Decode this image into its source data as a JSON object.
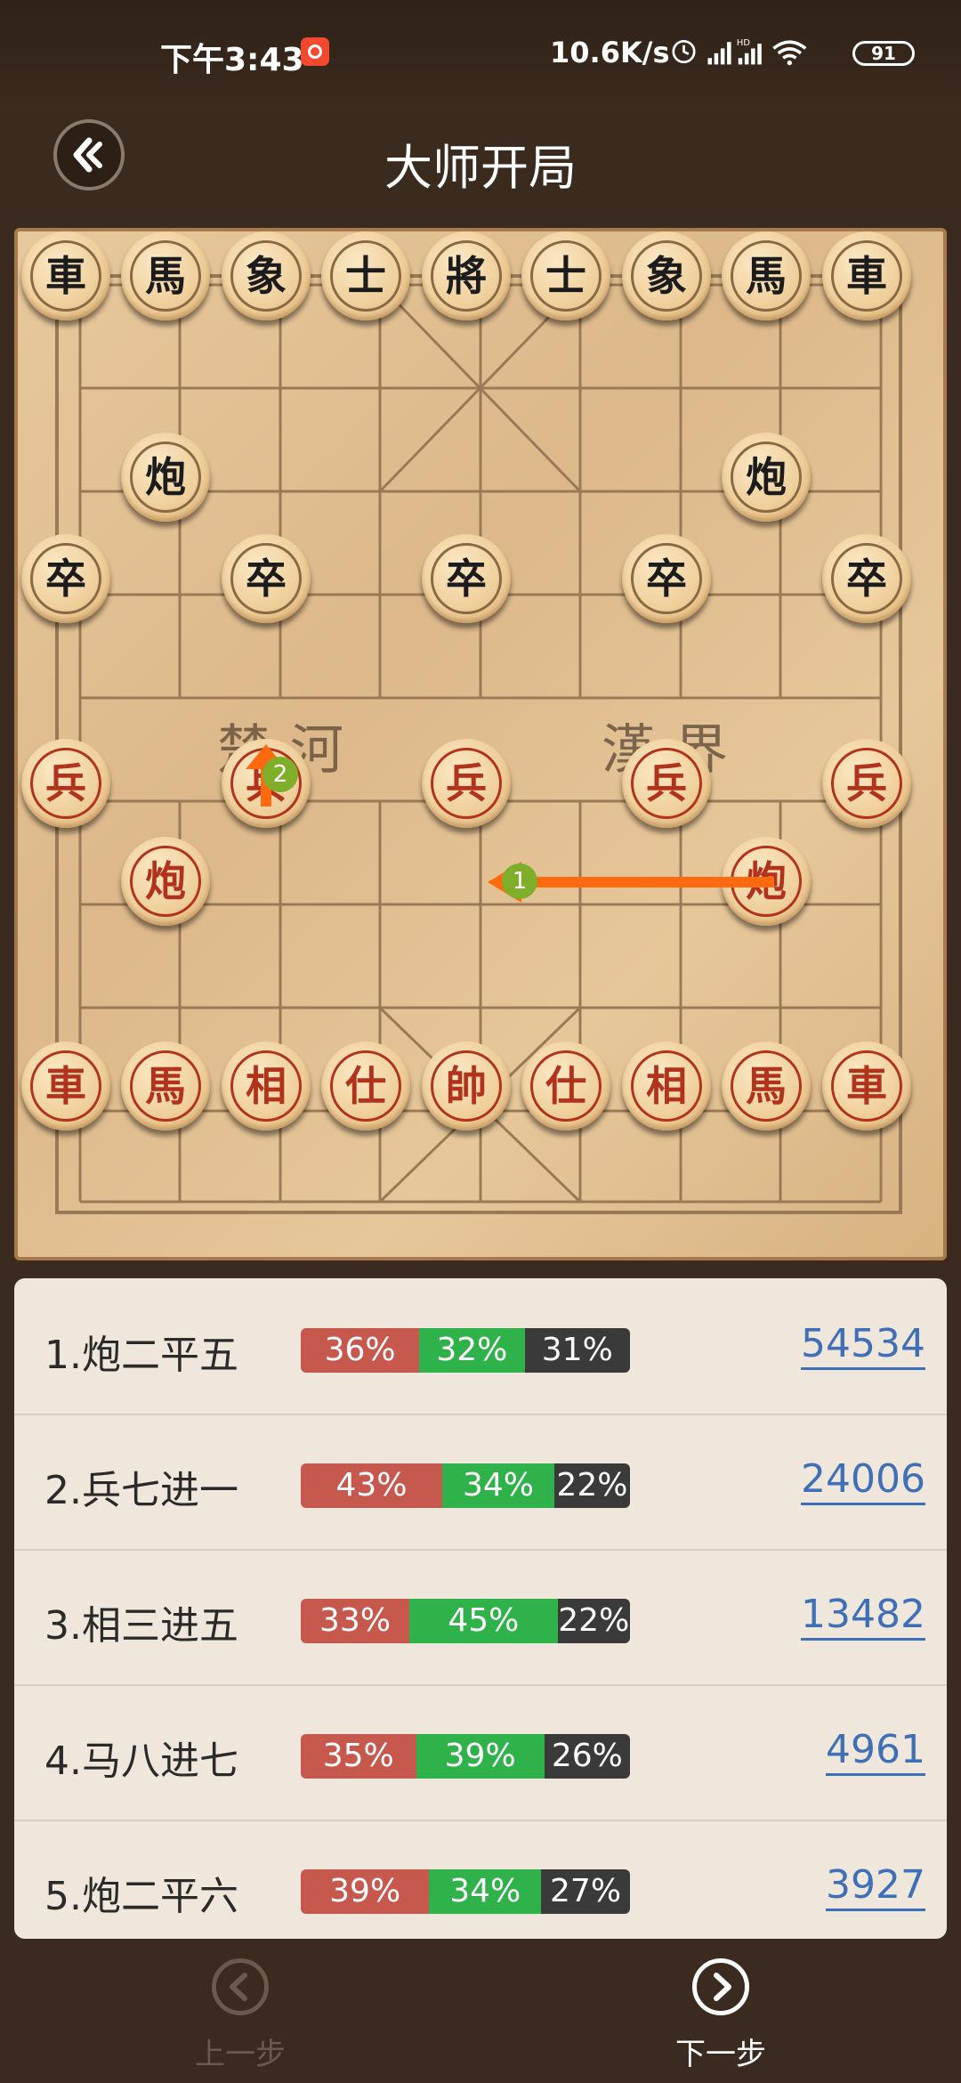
{
  "status_bar": {
    "time": "下午3:43",
    "speed": "10.6K/s",
    "battery": "91"
  },
  "header": {
    "title": "大师开局",
    "back_icon": "back-arrow-icon"
  },
  "board": {
    "river_left": "楚河",
    "river_right": "漢界",
    "black_pieces": {
      "back_row": [
        "車",
        "馬",
        "象",
        "士",
        "將",
        "士",
        "象",
        "馬",
        "車"
      ],
      "cannons": [
        "炮",
        "炮"
      ],
      "soldiers": [
        "卒",
        "卒",
        "卒",
        "卒",
        "卒"
      ]
    },
    "red_pieces": {
      "back_row": [
        "車",
        "馬",
        "相",
        "仕",
        "帥",
        "仕",
        "相",
        "馬",
        "車"
      ],
      "cannons": [
        "炮",
        "炮"
      ],
      "soldiers": [
        "兵",
        "兵",
        "兵",
        "兵",
        "兵"
      ]
    },
    "arrow_labels": [
      "1",
      "2"
    ],
    "arrow_color": "#ff6a10",
    "marker_color": "#7fae2a"
  },
  "moves": [
    {
      "name": "1.炮二平五",
      "red": "36%",
      "green": "32%",
      "dark": "31%",
      "count": "54534",
      "red_pct": 36,
      "green_pct": 32,
      "dark_pct": 31
    },
    {
      "name": "2.兵七进一",
      "red": "43%",
      "green": "34%",
      "dark": "22%",
      "count": "24006",
      "red_pct": 43,
      "green_pct": 34,
      "dark_pct": 22
    },
    {
      "name": "3.相三进五",
      "red": "33%",
      "green": "45%",
      "dark": "22%",
      "count": "13482",
      "red_pct": 33,
      "green_pct": 45,
      "dark_pct": 22
    },
    {
      "name": "4.马八进七",
      "red": "35%",
      "green": "39%",
      "dark": "26%",
      "count": "4961",
      "red_pct": 35,
      "green_pct": 39,
      "dark_pct": 26
    },
    {
      "name": "5.炮二平六",
      "red": "39%",
      "green": "34%",
      "dark": "27%",
      "count": "3927",
      "red_pct": 39,
      "green_pct": 34,
      "dark_pct": 27
    }
  ],
  "bottom": {
    "prev": "上一步",
    "next": "下一步"
  }
}
